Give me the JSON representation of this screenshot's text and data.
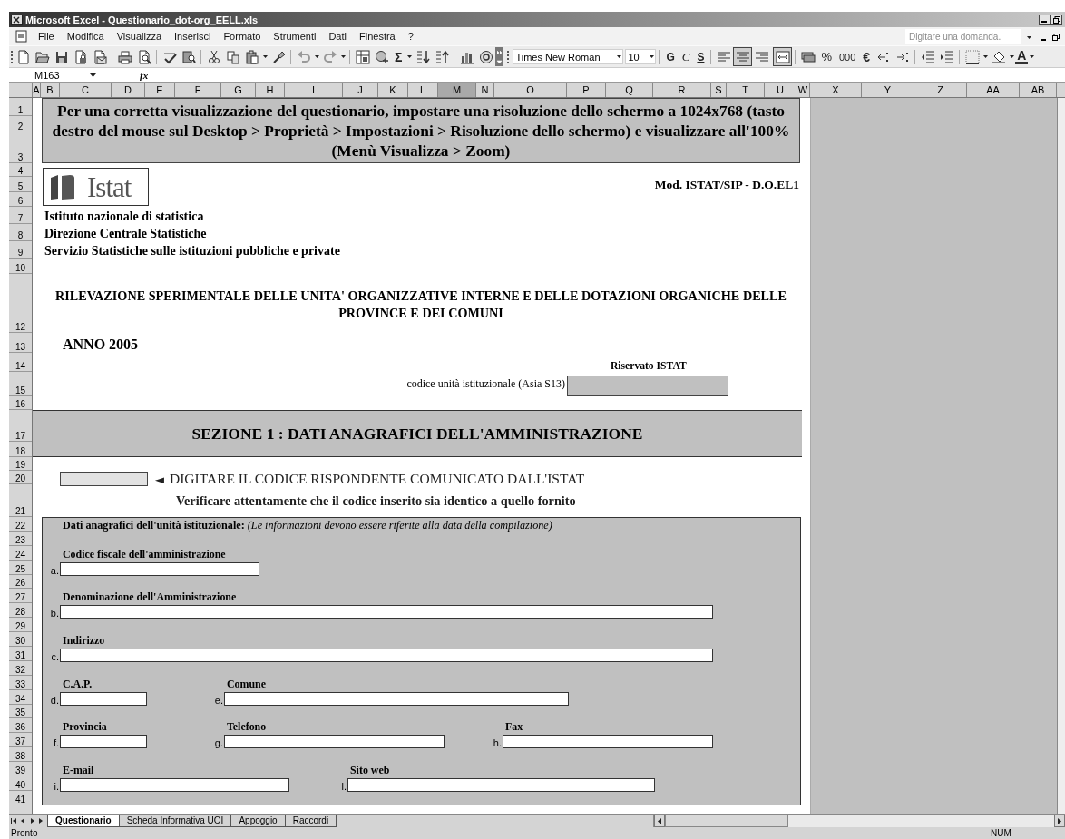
{
  "window": {
    "title": "Microsoft Excel - Questionario_dot-org_EELL.xls"
  },
  "menu": [
    "File",
    "Modifica",
    "Visualizza",
    "Inserisci",
    "Formato",
    "Strumenti",
    "Dati",
    "Finestra",
    "?"
  ],
  "help_box": {
    "placeholder": "Digitare una domanda."
  },
  "toolbar": {
    "autosum": "Σ",
    "font_name": "Times New Roman",
    "font_size": "10",
    "bold": "G",
    "italic": "C",
    "underline": "S",
    "align_buttons": [
      {
        "selected": false
      },
      {
        "selected": true
      },
      {
        "selected": false
      },
      {
        "selected": true
      }
    ],
    "percent": "%",
    "thousands": "000",
    "euro": "€",
    "font_color": "A"
  },
  "formula_bar": {
    "name_box": "M163",
    "fx": "fx"
  },
  "columns": [
    {
      "label": "A",
      "selected": false
    },
    {
      "label": "B",
      "selected": false
    },
    {
      "label": "C",
      "selected": false
    },
    {
      "label": "D",
      "selected": false
    },
    {
      "label": "E",
      "selected": false
    },
    {
      "label": "F",
      "selected": false
    },
    {
      "label": "G",
      "selected": false
    },
    {
      "label": "H",
      "selected": false
    },
    {
      "label": "I",
      "selected": false
    },
    {
      "label": "J",
      "selected": false
    },
    {
      "label": "K",
      "selected": false
    },
    {
      "label": "L",
      "selected": false
    },
    {
      "label": "M",
      "selected": true
    },
    {
      "label": "N",
      "selected": false
    },
    {
      "label": "O",
      "selected": false
    },
    {
      "label": "P",
      "selected": false
    },
    {
      "label": "Q",
      "selected": false
    },
    {
      "label": "R",
      "selected": false
    },
    {
      "label": "S",
      "selected": false
    },
    {
      "label": "T",
      "selected": false
    },
    {
      "label": "U",
      "selected": false
    },
    {
      "label": "W",
      "selected": false
    },
    {
      "label": "X",
      "selected": false
    },
    {
      "label": "Y",
      "selected": false
    },
    {
      "label": "Z",
      "selected": false
    },
    {
      "label": "AA",
      "selected": false
    },
    {
      "label": "AB",
      "selected": false
    }
  ],
  "rows": [
    "1",
    "2",
    "3",
    "4",
    "5",
    "6",
    "7",
    "8",
    "9",
    "10",
    "12",
    "13",
    "14",
    "15",
    "16",
    "17",
    "18",
    "19",
    "20",
    "21",
    "22",
    "23",
    "24",
    "25",
    "26",
    "27",
    "28",
    "29",
    "30",
    "31",
    "32",
    "33",
    "34",
    "35",
    "36",
    "37",
    "38",
    "39",
    "40",
    "41"
  ],
  "sheet": {
    "notice": "Per una corretta visualizzazione del questionario, impostare una risoluzione dello schermo a 1024x768 (tasto destro del mouse sul Desktop > Proprietà > Impostazioni > Risoluzione dello schermo) e visualizzare all'100% (Menù Visualizza > Zoom)",
    "logo_text": "Istat",
    "model_code": "Mod. ISTAT/SIP - D.O.EL1",
    "institute_lines": [
      "Istituto nazionale di statistica",
      "Direzione Centrale Statistiche",
      "Servizio Statistiche sulle istituzioni pubbliche e private"
    ],
    "survey_title": "RILEVAZIONE SPERIMENTALE DELLE UNITA' ORGANIZZATIVE INTERNE E DELLE DOTAZIONI ORGANICHE DELLE PROVINCE E DEI COMUNI",
    "year": "ANNO 2005",
    "reserved": {
      "heading": "Riservato ISTAT",
      "label": "codice unità istituzionale (Asia S13)"
    },
    "section_title": "SEZIONE 1 : DATI ANAGRAFICI DELL'AMMINISTRAZIONE",
    "code_entry": {
      "arrow": "◄",
      "instruction": "DIGITARE IL CODICE RISPONDENTE COMUNICATO DALL'ISTAT",
      "note": "Verificare attentamente che il codice inserito sia identico a quello fornito"
    },
    "form": {
      "heading": "**Dati anagrafici dell'unità istituzionale:** *(Le informazioni devono essere riferite alla data della compilazione)*",
      "lines": [
        [
          {
            "letter": "a.",
            "label": "Codice fiscale dell'amministrazione"
          }
        ],
        [
          {
            "letter": "b.",
            "label": "Denominazione dell'Amministrazione"
          }
        ],
        [
          {
            "letter": "c.",
            "label": "Indirizzo"
          }
        ],
        [
          {
            "letter": "d.",
            "label": "C.A.P."
          },
          {
            "letter": "e.",
            "label": "Comune"
          }
        ],
        [
          {
            "letter": "f.",
            "label": "Provincia"
          },
          {
            "letter": "g.",
            "label": "Telefono"
          },
          {
            "letter": "h.",
            "label": "Fax"
          }
        ],
        [
          {
            "letter": "i.",
            "label": "E-mail"
          },
          {
            "letter": "l.",
            "label": "Sito web"
          }
        ]
      ]
    }
  },
  "sheet_tabs": [
    {
      "label": "Questionario",
      "selected": true
    },
    {
      "label": "Scheda Informativa UOI",
      "selected": false
    },
    {
      "label": "Appoggio",
      "selected": false
    },
    {
      "label": "Raccordi",
      "selected": false
    }
  ],
  "status_bar": {
    "left": "Pronto",
    "right": "NUM"
  }
}
